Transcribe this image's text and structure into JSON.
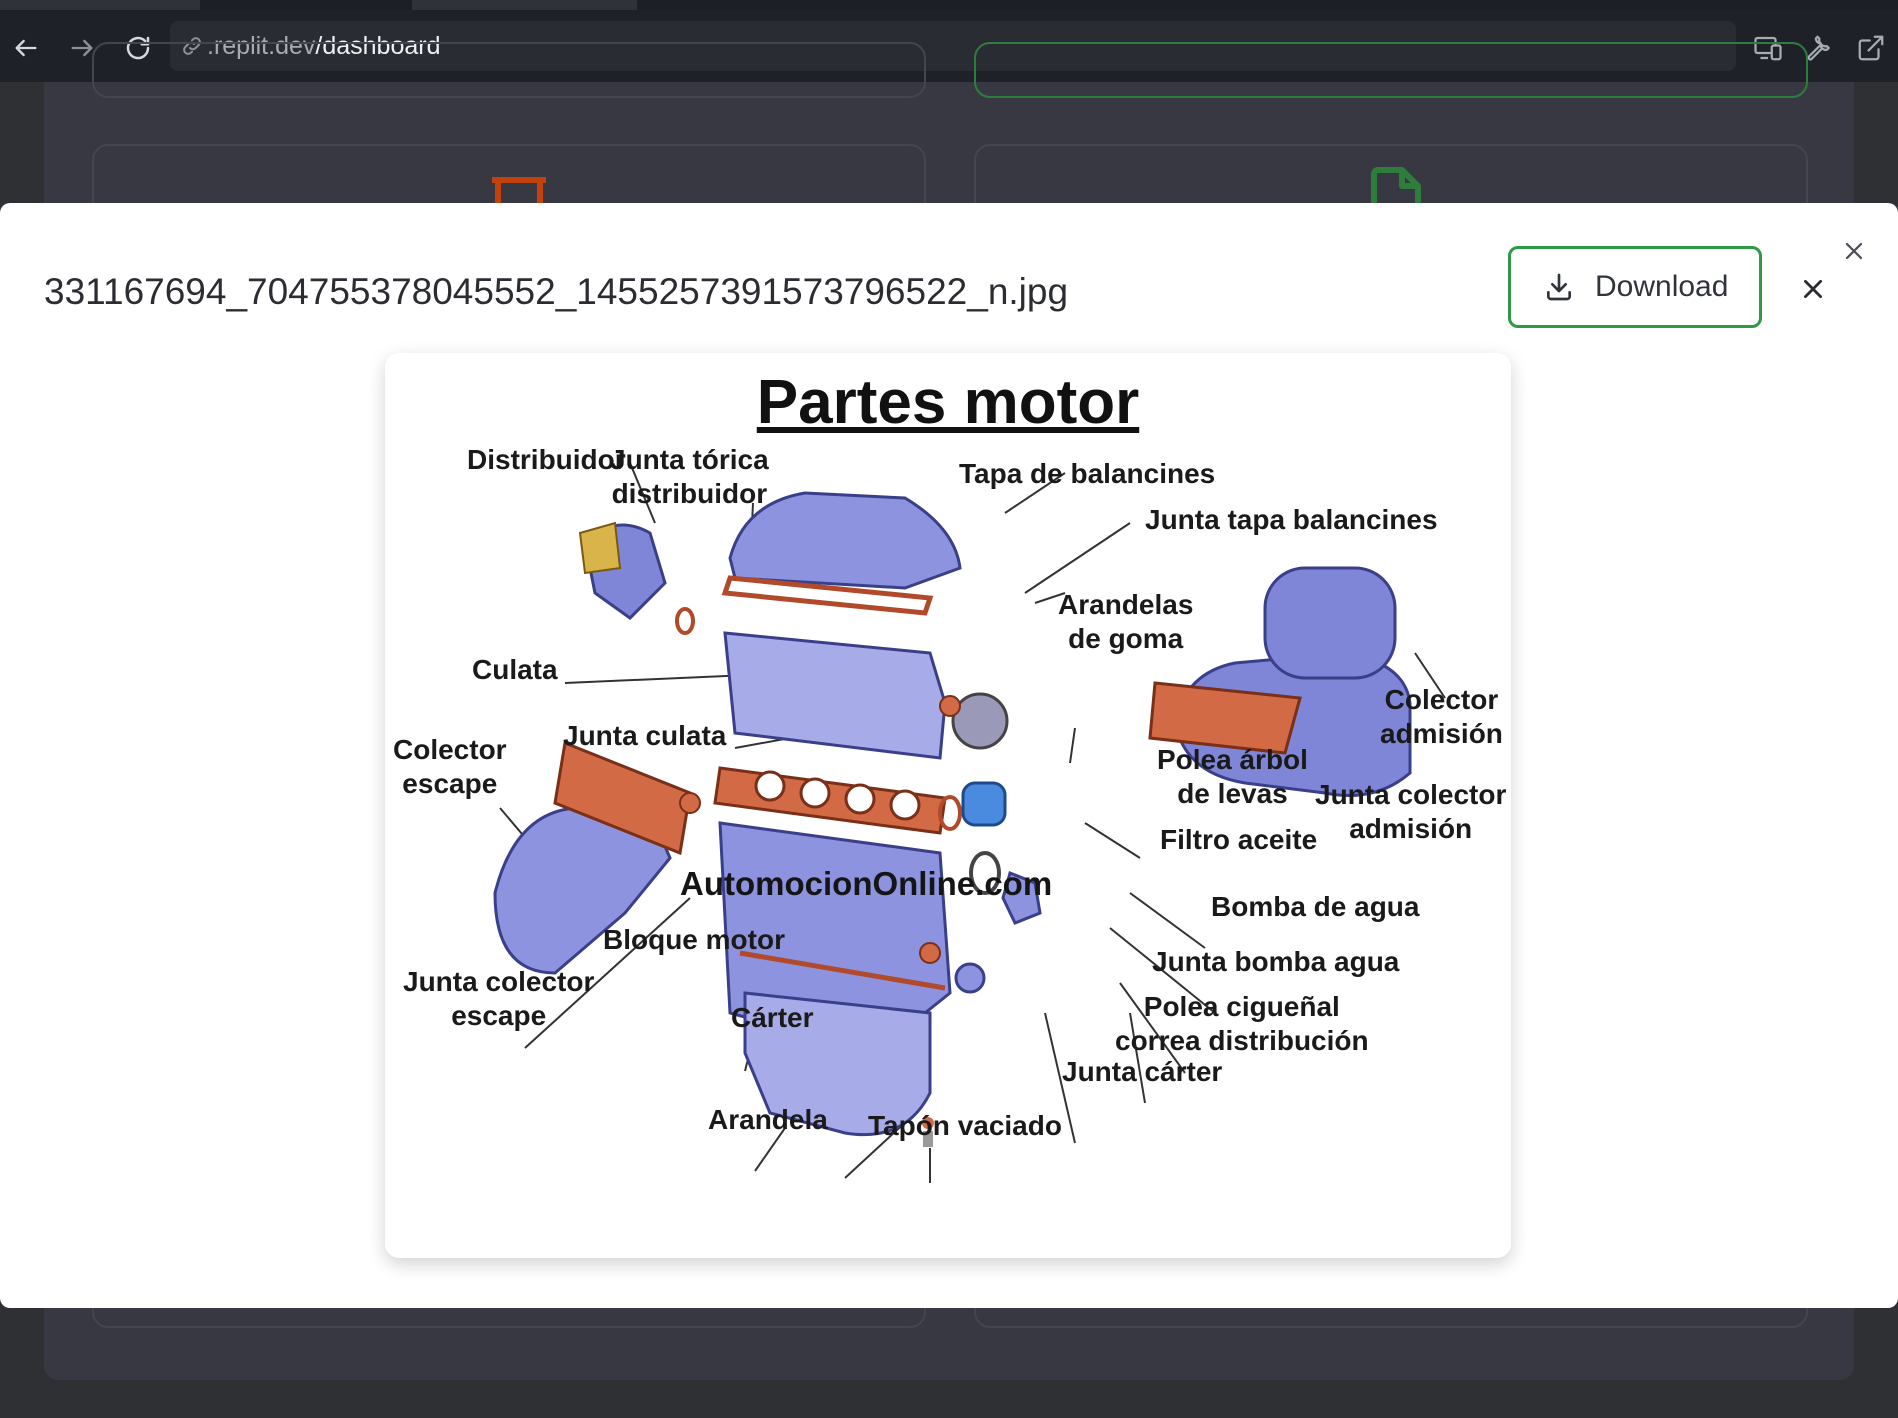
{
  "browser": {
    "url_host": ".replit.dev",
    "url_path": "/dashboard"
  },
  "modal": {
    "filename": "331167694_704755378045552_1455257391573796522_n.jpg",
    "download_label": "Download"
  },
  "diagram": {
    "title": "Partes motor",
    "watermark": "AutomocionOnline.com",
    "labels": {
      "distribuidor": "Distribuidor",
      "junta_torica_1": "Junta tórica",
      "junta_torica_2": "distribuidor",
      "tapa_balancines": "Tapa de balancines",
      "junta_tapa": "Junta tapa balancines",
      "arandelas_1": "Arandelas",
      "arandelas_2": "de goma",
      "culata": "Culata",
      "colector_adm_1": "Colector",
      "colector_adm_2": "admisión",
      "junta_culata": "Junta culata",
      "colector_esc_1": "Colector",
      "colector_esc_2": "escape",
      "polea_arbol_1": "Polea árbol",
      "polea_arbol_2": "de levas",
      "junta_col_adm_1": "Junta colector",
      "junta_col_adm_2": "admisión",
      "filtro_aceite": "Filtro aceite",
      "bomba_agua": "Bomba de agua",
      "bloque_motor": "Bloque motor",
      "junta_bomba": "Junta bomba agua",
      "junta_col_esc_1": "Junta colector",
      "junta_col_esc_2": "escape",
      "polea_cig_1": "Polea cigueñal",
      "polea_cig_2": "correa distribución",
      "carter": "Cárter",
      "junta_carter": "Junta cárter",
      "arandela": "Arandela",
      "tapon": "Tapón vaciado"
    }
  },
  "colors": {
    "download_border": "#2f9a44",
    "dashboard_bg": "#373841",
    "toolbar_bg": "#1f2128"
  },
  "icons": [
    "back-arrow-icon",
    "forward-arrow-icon",
    "reload-icon",
    "link-icon",
    "responsive-devices-icon",
    "wrench-icon",
    "open-external-icon",
    "download-icon",
    "close-icon"
  ]
}
